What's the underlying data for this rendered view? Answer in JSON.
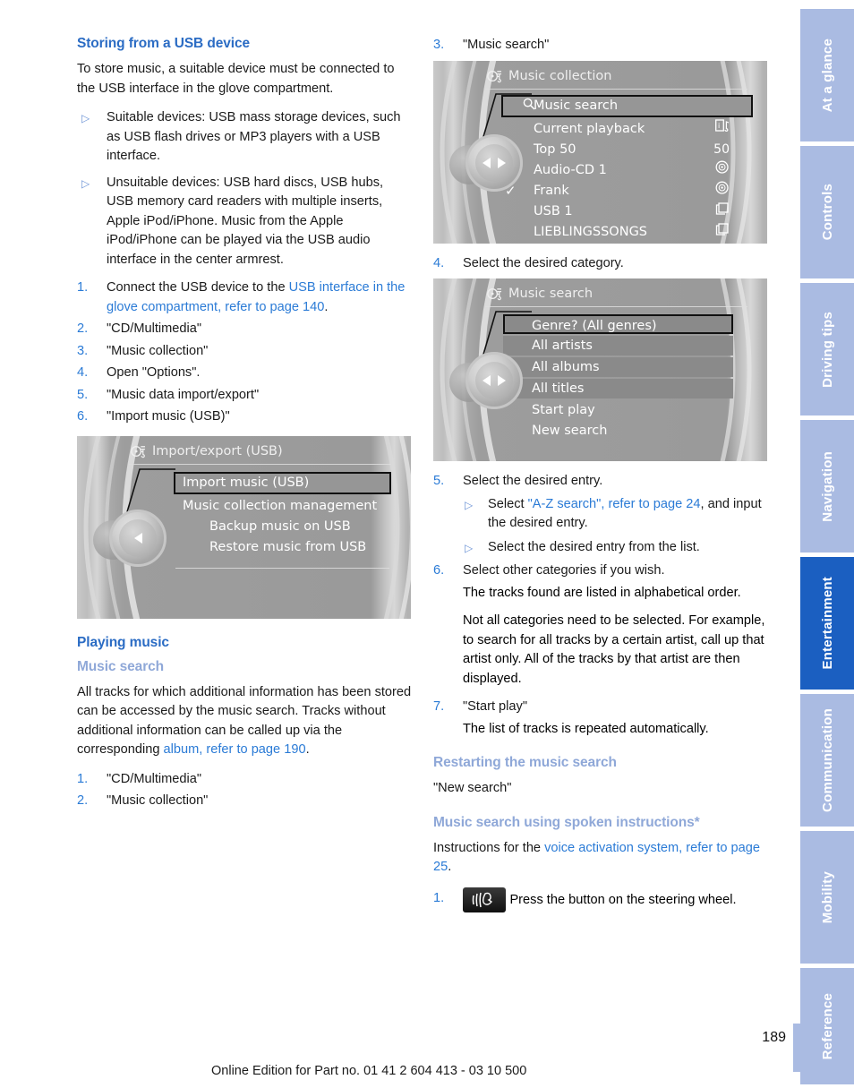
{
  "rail": {
    "tabs": [
      {
        "label": "At a glance",
        "active": false
      },
      {
        "label": "Controls",
        "active": false
      },
      {
        "label": "Driving tips",
        "active": false
      },
      {
        "label": "Navigation",
        "active": false
      },
      {
        "label": "Entertainment",
        "active": true
      },
      {
        "label": "Communication",
        "active": false
      },
      {
        "label": "Mobility",
        "active": false
      },
      {
        "label": "Reference",
        "active": false
      }
    ],
    "active_color": "#1b5fc1",
    "inactive_color": "#aabbe2"
  },
  "left": {
    "heading_usb": "Storing from a USB device",
    "intro": "To store music, a suitable device must be connected to the USB interface in the glove compartment.",
    "bullets": [
      "Suitable devices: USB mass storage devices, such as USB flash drives or MP3 players with a USB interface.",
      "Unsuitable devices: USB hard discs, USB hubs, USB memory card readers with multiple inserts, Apple iPod/iPhone. Music from the Apple iPod/iPhone can be played via the USB audio interface in the center armrest."
    ],
    "steps": [
      {
        "n": "1.",
        "pre": "Connect the USB device to the ",
        "link": "USB interface in the glove compartment, refer to page 140",
        "post": "."
      },
      {
        "n": "2.",
        "pre": "\"CD/Multimedia\"",
        "link": "",
        "post": ""
      },
      {
        "n": "3.",
        "pre": "\"Music collection\"",
        "link": "",
        "post": ""
      },
      {
        "n": "4.",
        "pre": "Open \"Options\".",
        "link": "",
        "post": ""
      },
      {
        "n": "5.",
        "pre": "\"Music data import/export\"",
        "link": "",
        "post": ""
      },
      {
        "n": "6.",
        "pre": "\"Import music (USB)\"",
        "link": "",
        "post": ""
      }
    ],
    "screen_import": {
      "title": "Import/export (USB)",
      "rows": [
        {
          "label": "Import music (USB)",
          "selected": true,
          "indent": 0
        },
        {
          "label": "Music collection management",
          "selected": false,
          "indent": 0
        },
        {
          "label": "Backup music on USB",
          "selected": false,
          "indent": 1
        },
        {
          "label": "Restore music from USB",
          "selected": false,
          "indent": 1
        }
      ]
    },
    "heading_playing": "Playing music",
    "heading_music_search": "Music search",
    "music_search_body_pre": "All tracks for which additional information has been stored can be accessed by the music search. Tracks without additional information can be called up via the corresponding ",
    "music_search_link": "album, refer to page 190",
    "music_search_body_post": ".",
    "steps2": [
      {
        "n": "1.",
        "text": "\"CD/Multimedia\""
      },
      {
        "n": "2.",
        "text": "\"Music collection\""
      }
    ]
  },
  "right": {
    "step3": {
      "n": "3.",
      "text": "\"Music search\""
    },
    "screen_collection": {
      "title": "Music collection",
      "rows": [
        {
          "label": "Music search",
          "value": "",
          "selected": true,
          "icon": "magnifier-icon",
          "check": false
        },
        {
          "label": "Current playback",
          "value": "",
          "selected": false,
          "icon": "track-info-icon",
          "check": false
        },
        {
          "label": "Top 50",
          "value": "50",
          "selected": false,
          "icon": "",
          "check": false
        },
        {
          "label": "Audio-CD 1",
          "value": "",
          "selected": false,
          "icon": "disc-icon",
          "check": false
        },
        {
          "label": "Frank",
          "value": "",
          "selected": false,
          "icon": "disc-icon",
          "check": true
        },
        {
          "label": "USB 1",
          "value": "",
          "selected": false,
          "icon": "folder-icon",
          "check": false
        },
        {
          "label": "LIEBLINGSSONGS",
          "value": "",
          "selected": false,
          "icon": "folder-icon",
          "check": false
        }
      ]
    },
    "step4": {
      "n": "4.",
      "text": "Select the desired category."
    },
    "screen_search": {
      "title": "Music search",
      "rows": [
        {
          "label": "Genre? (All genres)",
          "selected": true,
          "band": true
        },
        {
          "label": "All artists",
          "selected": false,
          "band": true
        },
        {
          "label": "All albums",
          "selected": false,
          "band": true
        },
        {
          "label": "All titles",
          "selected": false,
          "band": true
        },
        {
          "label": "Start play",
          "selected": false,
          "band": false
        },
        {
          "label": "New search",
          "selected": false,
          "band": false
        }
      ]
    },
    "step5": {
      "n": "5.",
      "text": "Select the desired entry."
    },
    "step5_bullets": [
      {
        "pre": "Select ",
        "link": "\"A-Z search\", refer to page 24",
        "post": ", and input the desired entry."
      },
      {
        "pre": "Select the desired entry from the list.",
        "link": "",
        "post": ""
      }
    ],
    "step6": {
      "n": "6.",
      "text": "Select other categories if you wish."
    },
    "step6_para1": "The tracks found are listed in alphabetical order.",
    "step6_para2": "Not all categories need to be selected. For example, to search for all tracks by a certain artist, call up that artist only. All of the tracks by that artist are then displayed.",
    "step7": {
      "n": "7.",
      "text": "\"Start play\""
    },
    "step7_para": "The list of tracks is repeated automatically.",
    "heading_restart": "Restarting the music search",
    "restart_text": "\"New search\"",
    "heading_spoken": "Music search using spoken instructions*",
    "spoken_pre": "Instructions for the ",
    "spoken_link": "voice activation system, refer to page 25",
    "spoken_post": ".",
    "voice_step": {
      "n": "1.",
      "text": "Press the button on the steering wheel.",
      "icon": "voice-button-icon"
    }
  },
  "footer": {
    "page_number": "189",
    "edition": "Online Edition for Part no. 01 41 2 604 413 - 03 10 500"
  }
}
